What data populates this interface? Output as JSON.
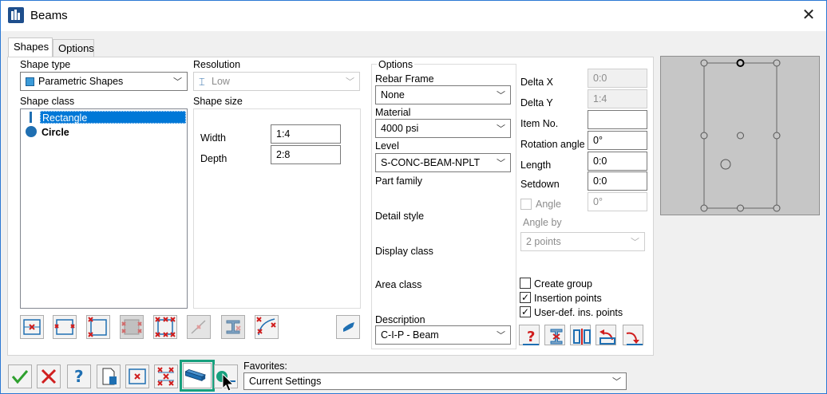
{
  "window": {
    "title": "Beams",
    "close_glyph": "✕"
  },
  "tabs": [
    {
      "label": "Shapes"
    },
    {
      "label": "Options"
    }
  ],
  "shape_type": {
    "label": "Shape type",
    "value": "Parametric Shapes"
  },
  "resolution": {
    "label": "Resolution",
    "value": "Low"
  },
  "shape_class": {
    "label": "Shape class",
    "items": [
      "Rectangle",
      "Circle"
    ]
  },
  "shape_size": {
    "label": "Shape size",
    "width_label": "Width",
    "width_value": "1:4",
    "depth_label": "Depth",
    "depth_value": "2:8"
  },
  "options": {
    "group_label": "Options",
    "rebar_frame_label": "Rebar Frame",
    "rebar_frame_value": "None",
    "material_label": "Material",
    "material_value": "4000 psi",
    "level_label": "Level",
    "level_value": "S-CONC-BEAM-NPLT",
    "part_family_label": "Part family",
    "detail_style_label": "Detail style",
    "display_class_label": "Display class",
    "area_class_label": "Area class",
    "description_label": "Description",
    "description_value": "C-I-P - Beam"
  },
  "placement": {
    "delta_x_label": "Delta X",
    "delta_x_value": "0:0",
    "delta_y_label": "Delta Y",
    "delta_y_value": "1:4",
    "item_no_label": "Item No.",
    "item_no_value": "",
    "rotation_label": "Rotation angle",
    "rotation_value": "0°",
    "length_label": "Length",
    "length_value": "0:0",
    "setdown_label": "Setdown",
    "setdown_value": "0:0",
    "angle_label": "Angle",
    "angle_value": "0°",
    "angle_by_label": "Angle by",
    "angle_by_value": "2 points"
  },
  "checkboxes": {
    "create_group": {
      "label": "Create group",
      "checked": false
    },
    "insertion_points": {
      "label": "Insertion points",
      "checked": true
    },
    "user_def_points": {
      "label": "User-def. ins. points",
      "checked": true
    }
  },
  "favorites": {
    "label": "Favorites:",
    "value": "Current Settings"
  },
  "colors": {
    "accent": "#2b78d4",
    "highlight": "#18a07e",
    "icon_red": "#d01e1e",
    "icon_blue": "#1f6fb2"
  }
}
